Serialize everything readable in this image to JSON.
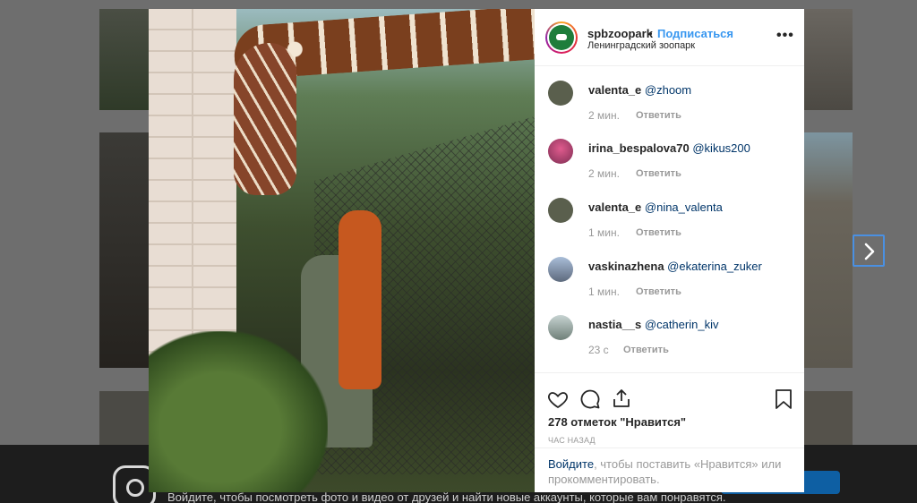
{
  "post": {
    "username": "spbzoopark",
    "dot": "•",
    "follow_label": "Подписаться",
    "location": "Ленинградский зоопарк",
    "more_label": "•••"
  },
  "comments": [
    {
      "user": "valenta_e",
      "mention": "@zhoom",
      "time": "2 мин.",
      "reply": "Ответить",
      "avatar_color": "#5a5f4d"
    },
    {
      "user": "irina_bespalova70",
      "mention": "@kikus200",
      "time": "2 мин.",
      "reply": "Ответить",
      "avatar_color": "#c23c6e"
    },
    {
      "user": "valenta_e",
      "mention": "@nina_valenta",
      "time": "1 мин.",
      "reply": "Ответить",
      "avatar_color": "#5a5f4d"
    },
    {
      "user": "vaskinazhena",
      "mention": "@ekaterina_zuker",
      "time": "1 мин.",
      "reply": "Ответить",
      "avatar_color": "#7b8fb0"
    },
    {
      "user": "nastia__s",
      "mention": "@catherin_kiv",
      "time": "23 с",
      "reply": "Ответить",
      "avatar_color": "#8fa3a0"
    }
  ],
  "actions": {
    "like_icon": "heart-icon",
    "comment_icon": "comment-icon",
    "share_icon": "share-icon",
    "save_icon": "bookmark-icon",
    "likes_text": "278 отметок \"Нравится\"",
    "time_ago": "ЧАС НАЗАД"
  },
  "login": {
    "link": "Войдите",
    "rest": ", чтобы поставить «Нравится» или прокомментировать."
  },
  "footer": {
    "text": "Войдите, чтобы посмотреть фото и видео от друзей и найти новые аккаунты, которые вам понравятся."
  },
  "colors": {
    "link_blue": "#3897f0",
    "mention_blue": "#003569"
  }
}
